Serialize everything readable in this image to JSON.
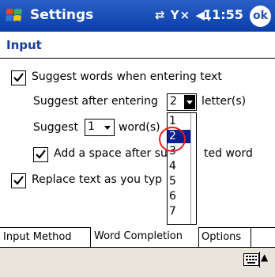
{
  "titlebar": {
    "title": "Settings",
    "status_icons": "⇄ Y× ◀(",
    "time": "11:55",
    "ok_label": "ok"
  },
  "page": {
    "title": "Input"
  },
  "options": {
    "suggest_words_label": "Suggest words when entering text",
    "suggest_after_label": "Suggest after entering",
    "suggest_after_value": "2",
    "letters_label": "letter(s)",
    "suggest_label": "Suggest",
    "suggest_value": "1",
    "words_label": "word(s)",
    "add_space_label_part1": "Add a space after su",
    "add_space_label_part2": "ted word",
    "replace_label": "Replace text as you typ"
  },
  "dropdown": {
    "options": [
      "1",
      "2",
      "3",
      "4",
      "5",
      "6",
      "7"
    ],
    "selected": "2"
  },
  "tabs": [
    "Input Method",
    "Word Completion",
    "Options"
  ],
  "colors": {
    "titlebar": "#1a4fb5",
    "selection": "#0a1f8f",
    "highlight_circle": "#e02020"
  }
}
